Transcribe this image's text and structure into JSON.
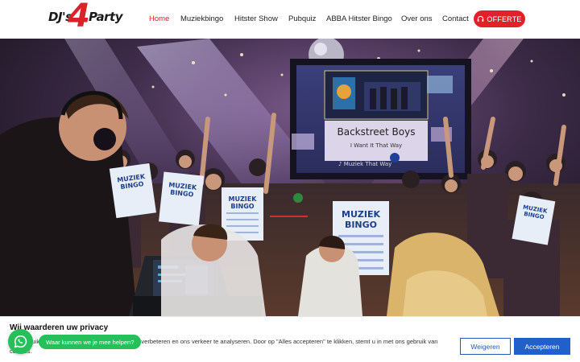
{
  "logo": {
    "part1": "DJ's",
    "part2": "4",
    "part3": "Party"
  },
  "nav": {
    "items": [
      {
        "label": "Home",
        "active": true
      },
      {
        "label": "Muziekbingo"
      },
      {
        "label": "Hitster Show"
      },
      {
        "label": "Pubquiz"
      },
      {
        "label": "ABBA Hitster Bingo"
      },
      {
        "label": "Over ons"
      },
      {
        "label": "Contact"
      }
    ],
    "cta_label": "OFFERTE",
    "cta_icon": "headphones-icon"
  },
  "hero": {
    "screen_title": "Backstreet Boys",
    "screen_subtitle": "I Want It That Way",
    "screen_ticker": "♪ Muziek That Way",
    "cards": [
      {
        "line1": "MUZIEK",
        "line2": "BINGO"
      },
      {
        "line1": "MUZIEK",
        "line2": "BINGO"
      },
      {
        "line1": "MUZIEK",
        "line2": "BINGO"
      },
      {
        "line1": "MUZIEK",
        "line2": "BINGO"
      },
      {
        "line1": "MUZIEK",
        "line2": "BINGO"
      }
    ]
  },
  "cookie": {
    "title": "Wij waarderen uw privacy",
    "text": "Wij gebruiken cookies om uw browse-ervaring te verbeteren en ons verkeer te analyseren. Door op \"Alles accepteren\" te klikken, stemt u in met ons gebruik van cookies.",
    "decline_label": "Weigeren",
    "accept_label": "Accepteren"
  },
  "whatsapp": {
    "tooltip": "Waar kunnen we je mee helpen?",
    "icon": "whatsapp-icon"
  },
  "colors": {
    "brand_red": "#e3202a",
    "accept_blue": "#2160c9",
    "whatsapp_green": "#25c05a"
  }
}
